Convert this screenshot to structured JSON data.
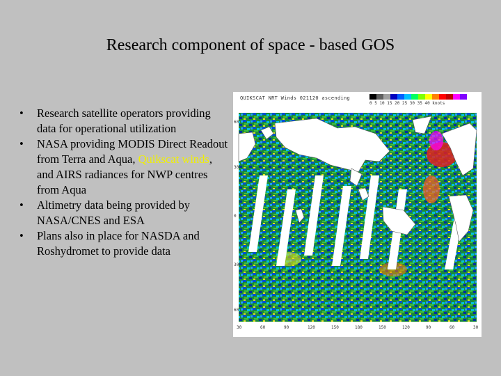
{
  "slide": {
    "title": "Research component of space - based GOS",
    "bullets": [
      {
        "segments": [
          {
            "text": "Research satellite operators providing data for operational utilization",
            "highlight": false
          }
        ]
      },
      {
        "segments": [
          {
            "text": "NASA providing MODIS Direct Readout from Terra and Aqua, ",
            "highlight": false
          },
          {
            "text": "Quikscat winds",
            "highlight": true
          },
          {
            "text": ", and AIRS radiances for NWP centres from Aqua",
            "highlight": false
          }
        ]
      },
      {
        "segments": [
          {
            "text": "Altimetry data being provided by NASA/CNES and ESA",
            "highlight": false
          }
        ]
      },
      {
        "segments": [
          {
            "text": "Plans also in place for NASDA and Roshydromet to provide data",
            "highlight": false
          }
        ]
      }
    ],
    "bullet_symbol": "•",
    "highlight_color": "#f0f000",
    "background_color": "#c0c0c0"
  },
  "map": {
    "header": "QUIKSCAT  NRT Winds  021120 ascending",
    "legend_colors": [
      "#000000",
      "#606060",
      "#a0a0a0",
      "#0000c0",
      "#0060ff",
      "#00c0ff",
      "#00ff60",
      "#80ff00",
      "#ffff00",
      "#ff8000",
      "#ff0000",
      "#c00000",
      "#ff00ff",
      "#8000ff",
      "#ffffff"
    ],
    "legend_labels": [
      "0",
      "5",
      "10",
      "15",
      "20",
      "25",
      "30",
      "35",
      "40",
      "knots"
    ],
    "lat_labels": [
      "60",
      "30",
      "0",
      "30",
      "60"
    ],
    "lon_labels": [
      "30",
      "60",
      "90",
      "120",
      "150",
      "180",
      "150",
      "120",
      "90",
      "60",
      "30"
    ]
  }
}
